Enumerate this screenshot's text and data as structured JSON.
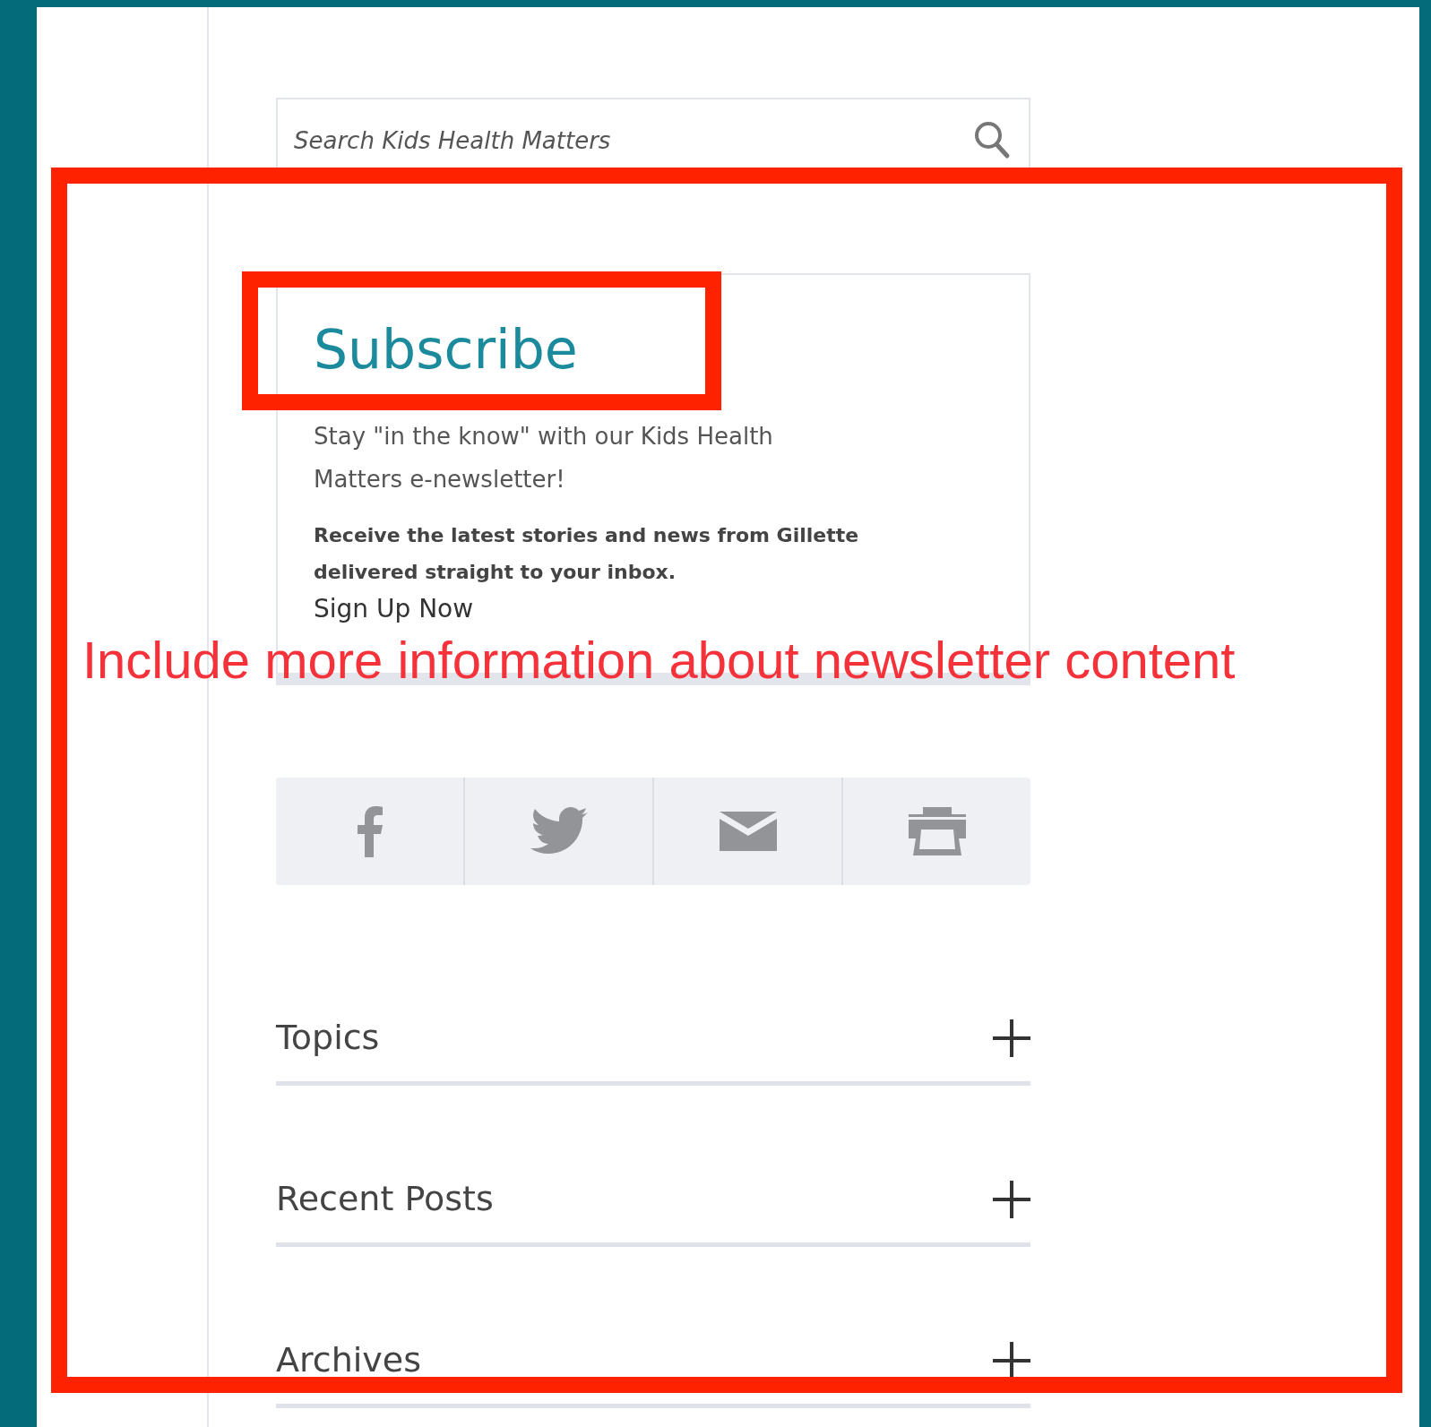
{
  "search": {
    "placeholder": "Search Kids Health Matters"
  },
  "subscribe": {
    "title": "Subscribe",
    "intro": "Stay \"in the know\" with our Kids Health Matters e-newsletter!",
    "details": "Receive the latest stories and news from Gillette delivered straight to your inbox.",
    "link": "Sign Up Now"
  },
  "share_buttons": [
    {
      "kind": "facebook"
    },
    {
      "kind": "twitter"
    },
    {
      "kind": "email"
    },
    {
      "kind": "print"
    }
  ],
  "sections": [
    {
      "label": "Topics",
      "expanded": false
    },
    {
      "label": "Recent Posts",
      "expanded": false
    },
    {
      "label": "Archives",
      "expanded": false
    }
  ],
  "annotation": {
    "note": "Include more information about newsletter content"
  }
}
